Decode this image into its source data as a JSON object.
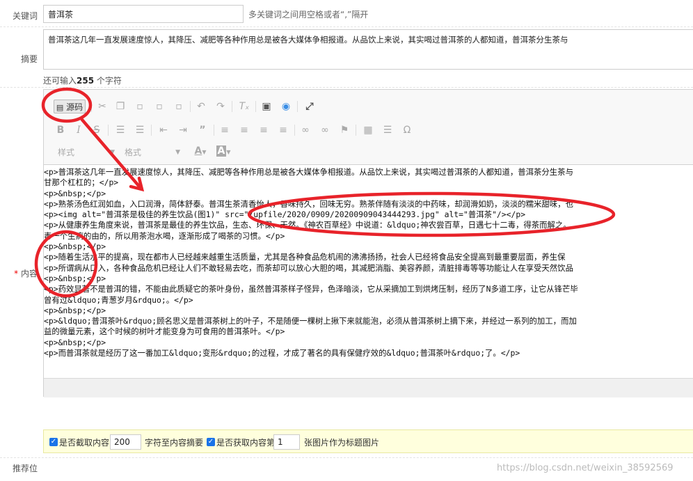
{
  "keywords": {
    "label": "关键词",
    "value": "普洱茶",
    "hint": "多关键词之间用空格或者“,”隔开"
  },
  "summary": {
    "label": "摘要",
    "value": "普洱茶这几年一直发展速度惊人，其降压、减肥等各种作用总是被各大媒体争相报道。从品饮上来说，其实喝过普洱茶的人都知道，普洱茶分生茶与",
    "remain_prefix": "还可输入",
    "remain_count": "255",
    "remain_suffix": " 个字符"
  },
  "content": {
    "label": "内容",
    "required_mark": "*"
  },
  "toolbar": {
    "source_label": "源码",
    "style_label": "样式",
    "format_label": "格式",
    "text_color_label": "A",
    "bg_color_label": "A"
  },
  "source_lines": [
    "<p>普洱茶这几年一直发展速度惊人，其降压、减肥等各种作用总是被各大媒体争相报道。从品饮上来说，其实喝过普洱茶的人都知道，普洱茶分生茶与",
    "甘那个杠杠的；</p>",
    "<p>&nbsp;</p>",
    "<p>熟茶汤色红润如血，入口润滑，简体舒泰。普洱生茶清香怡人，香味持久，回味无穷。熟茶伴随有淡淡的中药味，却润滑如奶，淡淡的糯米甜味，也",
    "<p><img alt=\"普洱茶是极佳的养生饮品(图1)\" src=\"/upfile/2020/0909/20200909043444293.jpg\" alt=\"普洱茶\"/></p>",
    "<p>从健康养生角度来说，普洱茶是最佳的养生饮品，生态、环保、天然。《神农百草经》中说道：&ldquo;神农尝百草，日遇七十二毒，得茶而解之。",
    "毒一个生病的由的，所以用茶泡水喝，逐渐形成了喝茶的习惯。</p>",
    "<p>&nbsp;</p>",
    "<p>随着生活水平的提高，现在都市人已经越来越重生活质量，尤其是各种食品危机闹的沸沸扬扬，社会人已经将食品安全提高到最重要层面，养生保",
    "<p>所谓病从口入，各种食品危机已经让人们不敢轻易去吃，而茶却可以放心大胆的喝，其减肥消脂、美容养颜，清脏排毒等等功能让人在享受天然饮品",
    "<p>&nbsp;</p>",
    "<p>药效显著不是普洱的错，不能由此质疑它的茶叶身份，虽然普洱茶样子怪异，色泽暗淡，它从采摘加工到烘烤压制，经历了N多道工序，让它从锋芒毕",
    "曾有过&ldquo;青葱岁月&rdquo;。</p>",
    "<p>&nbsp;</p>",
    "<p>&ldquo;普洱茶叶&rdquo;顾名思义是普洱茶树上的叶子，不是随便一棵树上揪下来就能泡，必须从普洱茶树上摘下来，并经过一系列的加工，而加",
    "益的微量元素，这个时候的树叶才能变身为可食用的普洱茶叶。</p>",
    "<p>&nbsp;</p>",
    "<p>而普洱茶就是经历了这一番加工&ldquo;变形&rdquo;的过程，才成了著名的具有保健疗效的&ldquo;普洱茶叶&rdquo;了。</p>"
  ],
  "options": {
    "auto_summary_label": "是否截取内容",
    "auto_summary_count": "200",
    "auto_summary_suffix": "字符至内容摘要",
    "auto_thumb_label": "是否获取内容第",
    "auto_thumb_index": "1",
    "auto_thumb_suffix": "张图片作为标题图片"
  },
  "recommend": {
    "label": "推荐位"
  },
  "watermark": "https://blog.csdn.net/weixin_38592569",
  "colors": {
    "annotation_red": "#e8232a",
    "checkbox_blue": "#1a73e8"
  }
}
